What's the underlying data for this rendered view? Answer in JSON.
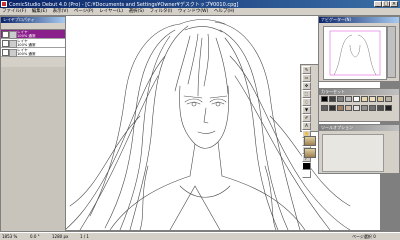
{
  "window": {
    "title": "ComicStudio Debut 4.0 (Pro) - [C:¥Documents and Settings¥Owner¥デスクトップ¥0010.cpg]",
    "minimize": "_",
    "maximize": "□",
    "close": "×"
  },
  "menu": [
    "ファイル(F)",
    "編集(E)",
    "表示(V)",
    "ページ(P)",
    "レイヤー(L)",
    "選択(S)",
    "フィルタ(I)",
    "ウィンドウ(W)",
    "ヘルプ(H)"
  ],
  "layers_panel": {
    "title": "レイヤプロパティ",
    "rows": [
      {
        "name": "レイヤ",
        "mode": "100% 通常",
        "selected": true
      },
      {
        "name": "レイヤ",
        "mode": "100% 通常",
        "selected": false
      },
      {
        "name": "レイヤ",
        "mode": "100% 通常",
        "selected": false
      }
    ]
  },
  "navigator_panel": {
    "title": "ナビゲーター(N)"
  },
  "color_panel": {
    "title": "カラーセット",
    "swatches": [
      "#000000",
      "#404040",
      "#808080",
      "#c0c0c0",
      "#ffffff",
      "#e8d8b0",
      "#f0e0c0",
      "#d8c8a0",
      "#b8b0a0",
      "#606060",
      "#303030",
      "#a08060",
      "#c8b8a8",
      "#e0e0e0",
      "#909090",
      "#707070",
      "#505050",
      "#202020"
    ]
  },
  "subtool_panel": {
    "title": "ツールオプション"
  },
  "status": {
    "zoom": "1853 %",
    "angle": "0.0 °",
    "size": "1280 px",
    "time": "1 / 1",
    "right": "ページ選択 0"
  },
  "colors": {
    "accent": "#0a246a",
    "selected_layer": "#8b1f8b",
    "panel_bg": "#d4d0c8"
  }
}
